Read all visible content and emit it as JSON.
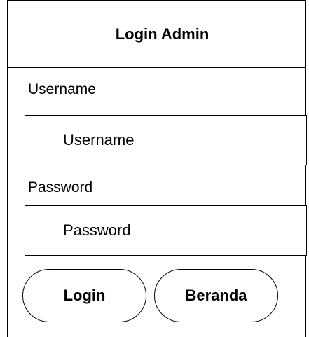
{
  "header": {
    "title": "Login Admin"
  },
  "form": {
    "username": {
      "label": "Username",
      "placeholder": "Username"
    },
    "password": {
      "label": "Password",
      "placeholder": "Password"
    }
  },
  "buttons": {
    "login_label": "Login",
    "beranda_label": "Beranda"
  }
}
